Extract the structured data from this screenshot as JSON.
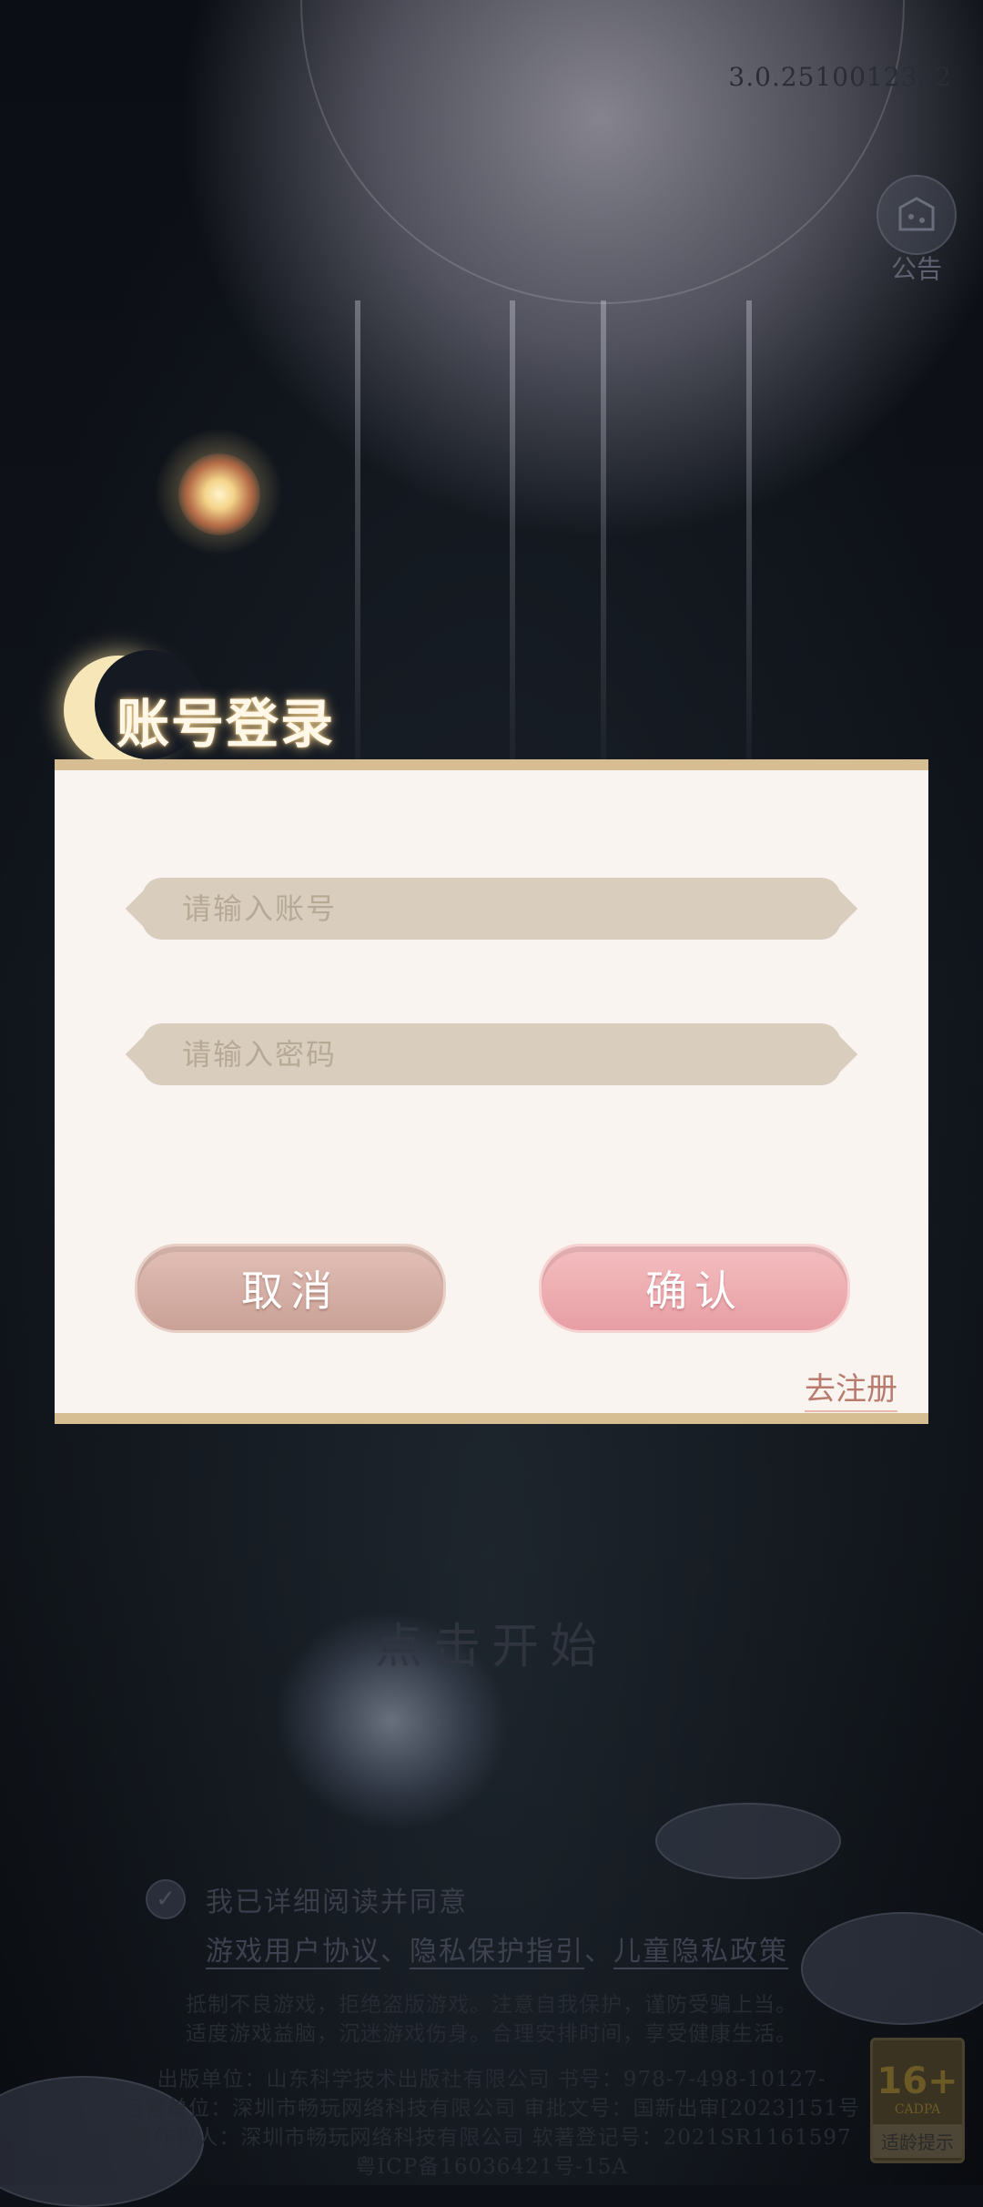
{
  "version": "3.0.2510012352",
  "notice": {
    "label": "公告"
  },
  "dialog": {
    "title": "账号登录",
    "account_placeholder": "请输入账号",
    "password_placeholder": "请输入密码",
    "cancel_label": "取消",
    "confirm_label": "确认",
    "register_label": "去注册"
  },
  "tap_start": "点击开始",
  "agreement": {
    "checkbox_label": "我已详细阅读并同意",
    "user_agreement": "游戏用户协议",
    "privacy_guide": "隐私保护指引",
    "child_privacy": "儿童隐私政策",
    "sep1": "、",
    "sep2": "、"
  },
  "legal": {
    "line1": "抵制不良游戏，拒绝盗版游戏。注意自我保护，谨防受骗上当。",
    "line2": "适度游戏益脑，沉迷游戏伤身。合理安排时间，享受健康生活。",
    "line3": "出版单位：山东科学技术出版社有限公司 书号：978-7-498-10127-",
    "line4": "运营单位：深圳市畅玩网络科技有限公司 审批文号：国新出审[2023]151号",
    "line5": "著作权人：深圳市畅玩网络科技有限公司 软著登记号：2021SR1161597",
    "line6": "粤ICP备16036421号-15A"
  },
  "age_rating": {
    "number": "16+",
    "org": "CADPA",
    "tip": "适龄提示"
  },
  "colors": {
    "dialog_bg": "#f9f4ef",
    "dialog_border": "#d6bd92",
    "input_bg": "#d9cdbd",
    "cancel_btn": "#d3aea4",
    "confirm_btn": "#eeaeb1",
    "register_text": "#b87b6e"
  }
}
